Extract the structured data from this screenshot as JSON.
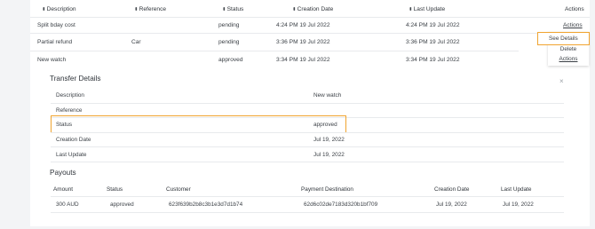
{
  "table": {
    "columns": [
      "Description",
      "Reference",
      "Status",
      "Creation Date",
      "Last Update",
      "Actions"
    ],
    "rows": [
      {
        "description": "Split bday cost",
        "reference": "",
        "status": "pending",
        "creation_date": "4:24 PM 19 Jul 2022",
        "last_update": "4:24 PM 19 Jul 2022",
        "action": "Actions"
      },
      {
        "description": "Partial refund",
        "reference": "Car",
        "status": "pending",
        "creation_date": "3:36 PM 19 Jul 2022",
        "last_update": "3:36 PM 19 Jul 2022",
        "action": ""
      },
      {
        "description": "New watch",
        "reference": "",
        "status": "approved",
        "creation_date": "3:34 PM 19 Jul 2022",
        "last_update": "3:34 PM 19 Jul 2022",
        "action": "Actions"
      }
    ],
    "menu": {
      "see_details": "See Details",
      "delete": "Delete"
    }
  },
  "details": {
    "title": "Transfer Details",
    "close_glyph": "×",
    "fields": [
      {
        "label": "Description",
        "value": "New watch"
      },
      {
        "label": "Reference",
        "value": ""
      },
      {
        "label": "Status",
        "value": "approved"
      },
      {
        "label": "Creation Date",
        "value": "Jul 19, 2022"
      },
      {
        "label": "Last Update",
        "value": "Jul 19, 2022"
      }
    ]
  },
  "payouts": {
    "title": "Payouts",
    "columns": [
      "Amount",
      "Status",
      "Customer",
      "Payment Destination",
      "Creation Date",
      "Last Update"
    ],
    "rows": [
      {
        "amount": "300 AUD",
        "status": "approved",
        "customer": "623f639b2b8c3b1e3d7d1b74",
        "destination": "62d6c02de7183d320b1bf709",
        "creation_date": "Jul 19, 2022",
        "last_update": "Jul 19, 2022"
      }
    ]
  },
  "colors": {
    "highlight": "#f0a430"
  }
}
